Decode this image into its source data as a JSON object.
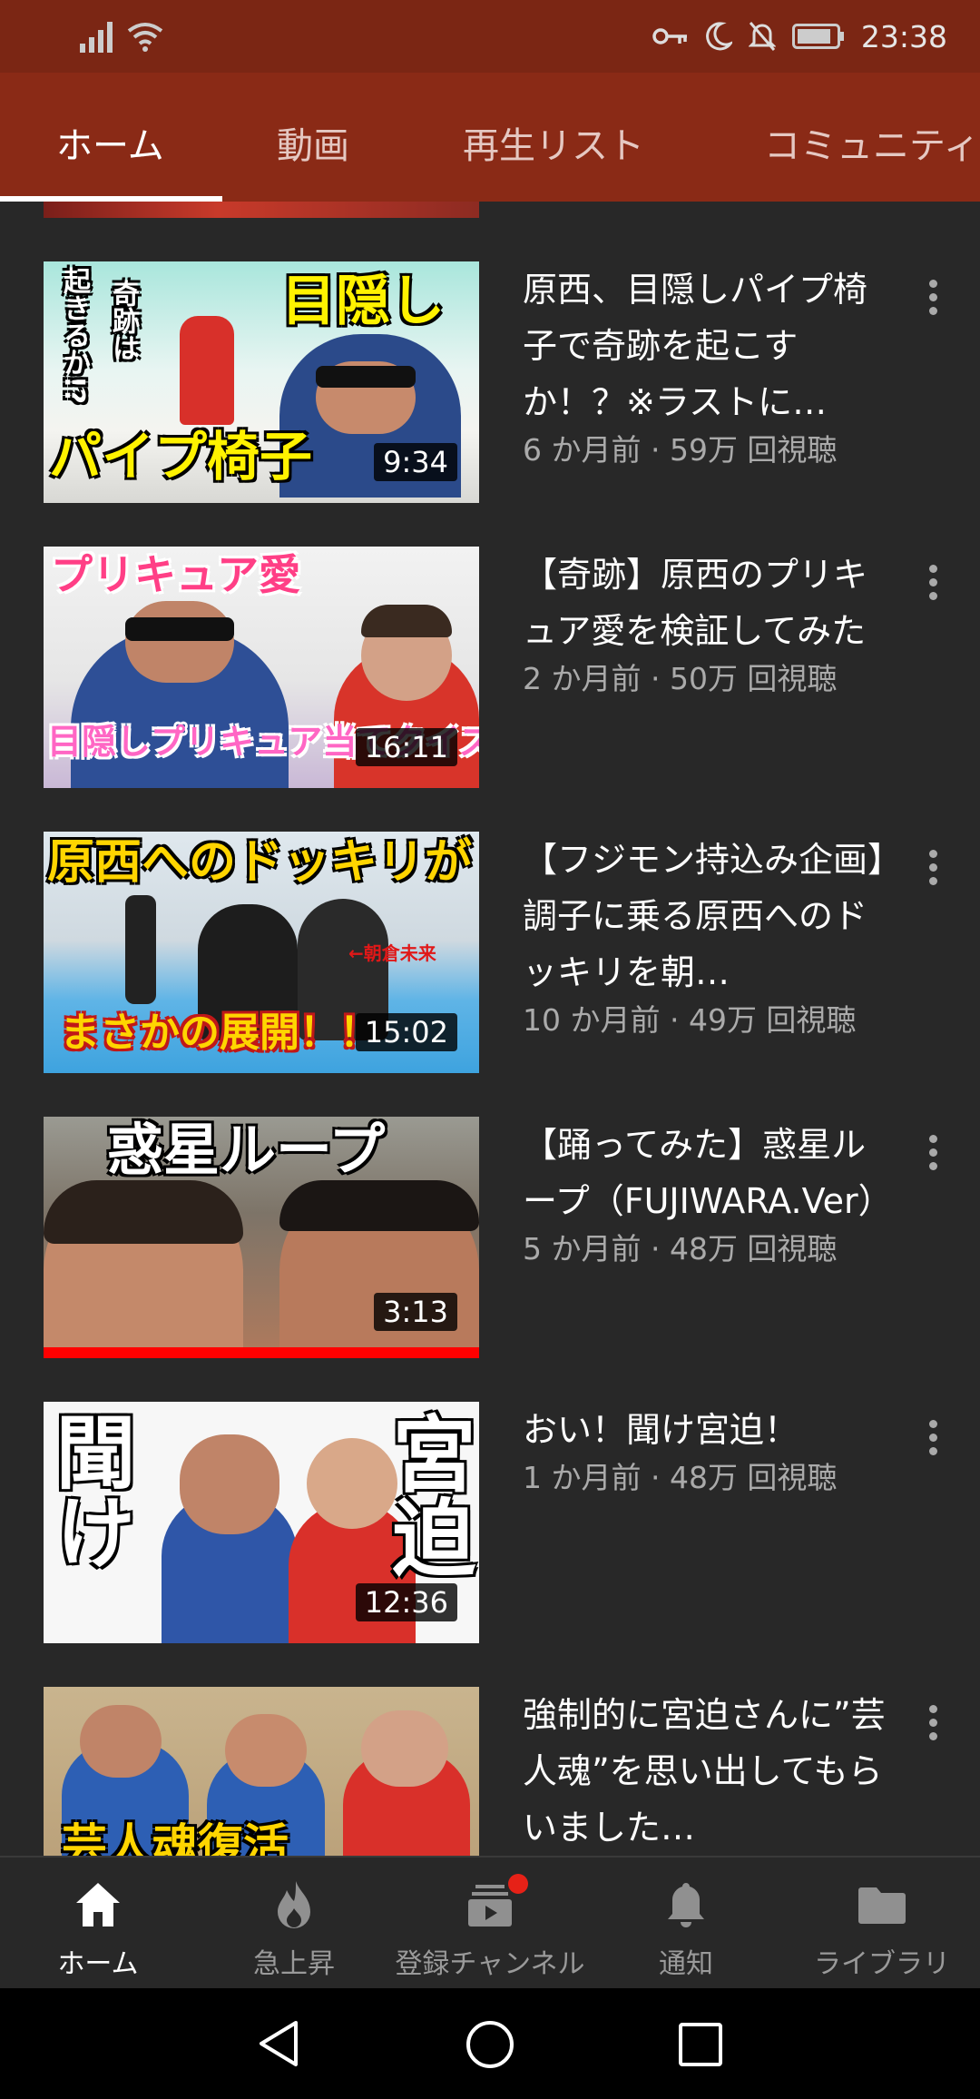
{
  "status_bar": {
    "time": "23:38"
  },
  "tabs": [
    {
      "label": "ホーム",
      "active": true
    },
    {
      "label": "動画",
      "active": false
    },
    {
      "label": "再生リスト",
      "active": false
    },
    {
      "label": "コミュニティ",
      "active": false
    }
  ],
  "videos": [
    {
      "thumb_text": [
        "目隠し",
        "パイプ椅子",
        "奇跡は",
        "起きるか!?"
      ],
      "duration": "9:34",
      "title": "原西、目隠しパイプ椅子で奇跡を起こすか！？※ラストに…",
      "views": "6 か月前 · 59万 回視聴"
    },
    {
      "thumb_text": [
        "プリキュア愛",
        "目隠しプリキュア当てクイズ"
      ],
      "duration": "16:11",
      "title": "【奇跡】原西のプリキュア愛を検証してみた",
      "views": "2 か月前 · 50万 回視聴"
    },
    {
      "thumb_text": [
        "原西へのドッキリが",
        "まさかの展開！！",
        "←朝倉未来"
      ],
      "duration": "15:02",
      "title": "【フジモン持込み企画】調子に乗る原西へのドッキリを朝…",
      "views": "10 か月前 · 49万 回視聴"
    },
    {
      "thumb_text": [
        "惑星ループ"
      ],
      "duration": "3:13",
      "title": "【踊ってみた】惑星ループ（FUJIWARA.Ver）",
      "views": "5 か月前 · 48万 回視聴"
    },
    {
      "thumb_text": [
        "聞け",
        "宮迫"
      ],
      "duration": "12:36",
      "title": "おい！聞け宮迫！",
      "views": "1 か月前 · 48万 回視聴"
    },
    {
      "thumb_text": [
        "芸人魂復活"
      ],
      "duration": "",
      "title": "強制的に宮迫さんに”芸人魂”を思い出してもらいました…",
      "views": ""
    }
  ],
  "bottom_nav": [
    {
      "label": "ホーム",
      "icon": "home-icon",
      "active": true
    },
    {
      "label": "急上昇",
      "icon": "flame-icon",
      "active": false
    },
    {
      "label": "登録チャンネル",
      "icon": "subscriptions-icon",
      "active": false
    },
    {
      "label": "通知",
      "icon": "bell-icon",
      "active": false
    },
    {
      "label": "ライブラリ",
      "icon": "folder-icon",
      "active": false
    }
  ],
  "colors": {
    "accent": "#8a2a16",
    "status_bar": "#7b2614",
    "background": "#282828",
    "notification_badge": "#e62117"
  }
}
